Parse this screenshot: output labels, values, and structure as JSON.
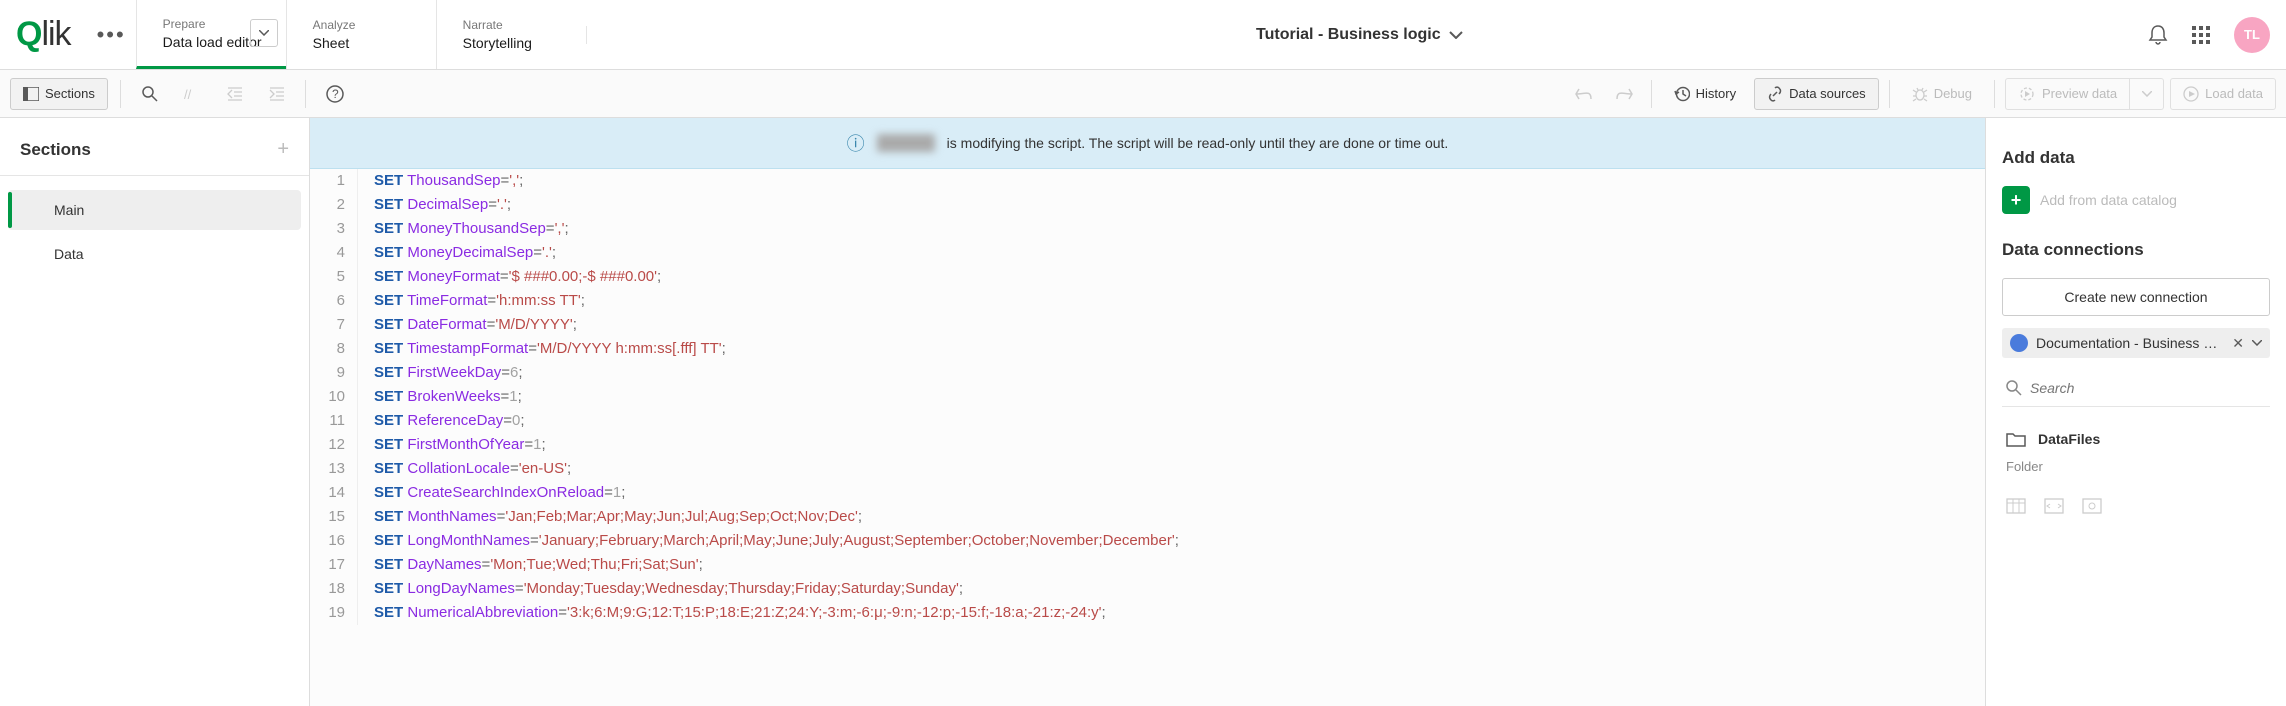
{
  "header": {
    "logo": "Qlik",
    "tabs": [
      {
        "label": "Prepare",
        "value": "Data load editor",
        "active": true,
        "hasDropdown": true
      },
      {
        "label": "Analyze",
        "value": "Sheet",
        "active": false
      },
      {
        "label": "Narrate",
        "value": "Storytelling",
        "active": false
      }
    ],
    "app_title": "Tutorial - Business logic",
    "avatar": "TL"
  },
  "toolbar": {
    "sections_btn": "Sections",
    "history": "History",
    "data_sources": "Data sources",
    "debug": "Debug",
    "preview": "Preview data",
    "load": "Load data"
  },
  "sections": {
    "title": "Sections",
    "items": [
      {
        "label": "Main",
        "active": true
      },
      {
        "label": "Data",
        "active": false
      }
    ]
  },
  "banner": {
    "text": "is modifying the script. The script will be read-only until they are done or time out."
  },
  "code": [
    {
      "n": 1,
      "kw": "SET",
      "var": "ThousandSep",
      "rest": "=',';",
      "isStr": true,
      "str": "','"
    },
    {
      "n": 2,
      "kw": "SET",
      "var": "DecimalSep",
      "str": "'.'"
    },
    {
      "n": 3,
      "kw": "SET",
      "var": "MoneyThousandSep",
      "str": "','"
    },
    {
      "n": 4,
      "kw": "SET",
      "var": "MoneyDecimalSep",
      "str": "'.'"
    },
    {
      "n": 5,
      "kw": "SET",
      "var": "MoneyFormat",
      "str": "'$ ###0.00;-$ ###0.00'"
    },
    {
      "n": 6,
      "kw": "SET",
      "var": "TimeFormat",
      "str": "'h:mm:ss TT'"
    },
    {
      "n": 7,
      "kw": "SET",
      "var": "DateFormat",
      "str": "'M/D/YYYY'"
    },
    {
      "n": 8,
      "kw": "SET",
      "var": "TimestampFormat",
      "str": "'M/D/YYYY h:mm:ss[.fff] TT'"
    },
    {
      "n": 9,
      "kw": "SET",
      "var": "FirstWeekDay",
      "num": "6"
    },
    {
      "n": 10,
      "kw": "SET",
      "var": "BrokenWeeks",
      "num": "1"
    },
    {
      "n": 11,
      "kw": "SET",
      "var": "ReferenceDay",
      "num": "0"
    },
    {
      "n": 12,
      "kw": "SET",
      "var": "FirstMonthOfYear",
      "num": "1"
    },
    {
      "n": 13,
      "kw": "SET",
      "var": "CollationLocale",
      "str": "'en-US'"
    },
    {
      "n": 14,
      "kw": "SET",
      "var": "CreateSearchIndexOnReload",
      "num": "1"
    },
    {
      "n": 15,
      "kw": "SET",
      "var": "MonthNames",
      "str": "'Jan;Feb;Mar;Apr;May;Jun;Jul;Aug;Sep;Oct;Nov;Dec'"
    },
    {
      "n": 16,
      "kw": "SET",
      "var": "LongMonthNames",
      "str": "'January;February;March;April;May;June;July;August;September;October;November;December'"
    },
    {
      "n": 17,
      "kw": "SET",
      "var": "DayNames",
      "str": "'Mon;Tue;Wed;Thu;Fri;Sat;Sun'"
    },
    {
      "n": 18,
      "kw": "SET",
      "var": "LongDayNames",
      "str": "'Monday;Tuesday;Wednesday;Thursday;Friday;Saturday;Sunday'"
    },
    {
      "n": 19,
      "kw": "SET",
      "var": "NumericalAbbreviation",
      "str": "'3:k;6:M;9:G;12:T;15:P;18:E;21:Z;24:Y;-3:m;-6:μ;-9:n;-12:p;-15:f;-18:a;-21:z;-24:y'"
    }
  ],
  "right": {
    "add_data": "Add data",
    "add_catalog": "Add from data catalog",
    "connections": "Data connections",
    "create_conn": "Create new connection",
    "conn_name": "Documentation - Business Logic ...",
    "search_placeholder": "Search",
    "datafiles": "DataFiles",
    "folder": "Folder"
  }
}
